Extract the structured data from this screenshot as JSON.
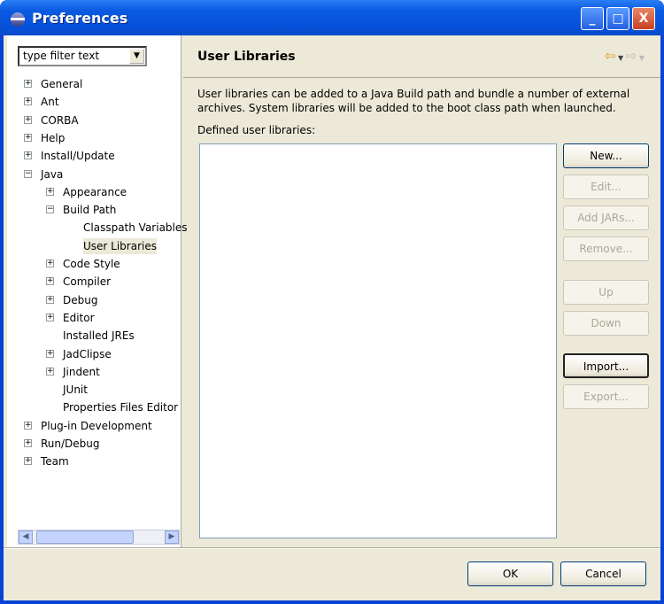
{
  "window": {
    "title": "Preferences",
    "minimize": "_",
    "maximize": "□",
    "close": "X"
  },
  "filter": {
    "placeholder": "type filter text"
  },
  "tree": [
    {
      "label": "General",
      "level": 0,
      "exp": "+"
    },
    {
      "label": "Ant",
      "level": 0,
      "exp": "+"
    },
    {
      "label": "CORBA",
      "level": 0,
      "exp": "+"
    },
    {
      "label": "Help",
      "level": 0,
      "exp": "+"
    },
    {
      "label": "Install/Update",
      "level": 0,
      "exp": "+"
    },
    {
      "label": "Java",
      "level": 0,
      "exp": "-"
    },
    {
      "label": "Appearance",
      "level": 1,
      "exp": "+"
    },
    {
      "label": "Build Path",
      "level": 1,
      "exp": "-"
    },
    {
      "label": "Classpath Variables",
      "level": 2,
      "exp": ""
    },
    {
      "label": "User Libraries",
      "level": 2,
      "exp": "",
      "selected": true
    },
    {
      "label": "Code Style",
      "level": 1,
      "exp": "+"
    },
    {
      "label": "Compiler",
      "level": 1,
      "exp": "+"
    },
    {
      "label": "Debug",
      "level": 1,
      "exp": "+"
    },
    {
      "label": "Editor",
      "level": 1,
      "exp": "+"
    },
    {
      "label": "Installed JREs",
      "level": 1,
      "exp": ""
    },
    {
      "label": "JadClipse",
      "level": 1,
      "exp": "+"
    },
    {
      "label": "Jindent",
      "level": 1,
      "exp": "+"
    },
    {
      "label": "JUnit",
      "level": 1,
      "exp": ""
    },
    {
      "label": "Properties Files Editor",
      "level": 1,
      "exp": ""
    },
    {
      "label": "Plug-in Development",
      "level": 0,
      "exp": "+"
    },
    {
      "label": "Run/Debug",
      "level": 0,
      "exp": "+"
    },
    {
      "label": "Team",
      "level": 0,
      "exp": "+"
    }
  ],
  "page": {
    "title": "User Libraries",
    "description": "User libraries can be added to a Java Build path and bundle a number of external archives. System libraries will be added to the boot class path when launched.",
    "list_label": "Defined user libraries:"
  },
  "buttons": [
    {
      "label": "New...",
      "enabled": true
    },
    {
      "label": "Edit...",
      "enabled": false
    },
    {
      "label": "Add JARs...",
      "enabled": false
    },
    {
      "label": "Remove...",
      "enabled": false
    },
    {
      "label": "Up",
      "enabled": false
    },
    {
      "label": "Down",
      "enabled": false
    },
    {
      "label": "Import...",
      "enabled": true,
      "focused": true
    },
    {
      "label": "Export...",
      "enabled": false
    }
  ],
  "footer": {
    "ok": "OK",
    "cancel": "Cancel"
  }
}
